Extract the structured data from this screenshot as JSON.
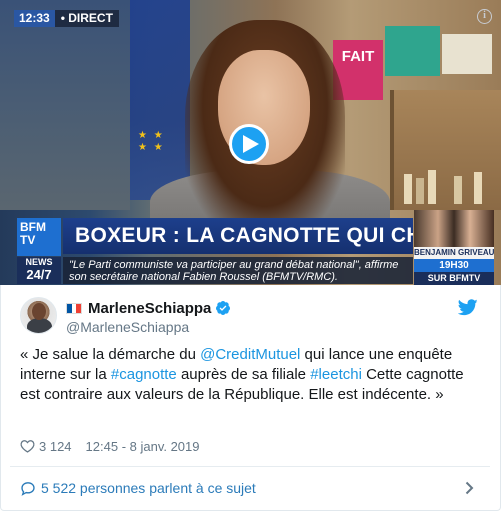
{
  "video": {
    "time": "12:33",
    "live_label": "• DIRECT",
    "poster_text": "FAIT",
    "headline": "BOXEUR : LA CAGNOTTE QUI CHOQUE",
    "channel_logo": "BFM TV",
    "news_label": "NEWS",
    "news_hours": "24/7",
    "ticker_line1": "\"Le Parti communiste va participer au grand débat national\", affirme",
    "ticker_line2": "son secrétaire national Fabien Roussel (BFMTV/RMC).",
    "promo_name": "BENJAMIN GRIVEAUX",
    "promo_time": "19H30",
    "promo_channel": "SUR BFMTV",
    "info_icon": "i"
  },
  "tweet": {
    "display_name": "MarleneSchiappa",
    "handle": "@MarleneSchiappa",
    "text_part1": "« Je salue la démarche du ",
    "mention": "@CreditMutuel",
    "text_part2": " qui lance une enquête interne sur la ",
    "hashtag1": "#cagnotte",
    "text_part3": " auprès de sa filiale ",
    "hashtag2": "#leetchi",
    "text_part4": " Cette cagnotte est contraire aux valeurs de la République. Elle est indécente. »",
    "likes": "3 124",
    "timestamp": "12:45 - 8 janv. 2019",
    "conversation": "5 522 personnes parlent à ce sujet"
  },
  "colors": {
    "twitter_blue": "#1da1f2",
    "link_blue": "#1b95e0",
    "muted_gray": "#657786",
    "bfm_blue": "#1d3f8c"
  },
  "icons": [
    "play-icon",
    "info-icon",
    "flag-fr-icon",
    "verified-icon",
    "twitter-bird-icon",
    "heart-icon",
    "chat-bubble-icon",
    "chevron-right-icon"
  ]
}
